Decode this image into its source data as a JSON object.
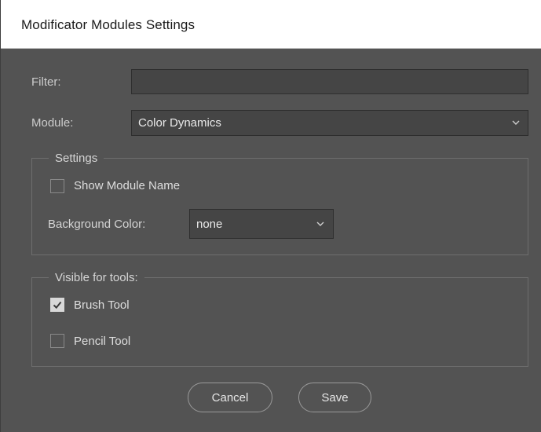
{
  "window": {
    "title": "Modificator Modules Settings"
  },
  "filter": {
    "label": "Filter:",
    "value": ""
  },
  "module": {
    "label": "Module:",
    "selected": "Color Dynamics"
  },
  "settings": {
    "legend": "Settings",
    "show_module_name": {
      "label": "Show Module Name",
      "checked": false
    },
    "background_color": {
      "label": "Background Color:",
      "selected": "none"
    }
  },
  "visible_for_tools": {
    "legend": "Visible for tools:",
    "items": [
      {
        "label": "Brush Tool",
        "checked": true
      },
      {
        "label": "Pencil Tool",
        "checked": false
      }
    ]
  },
  "buttons": {
    "cancel": "Cancel",
    "save": "Save"
  },
  "colors": {
    "panel": "#535353",
    "field": "#454545",
    "titlebar": "#ffffff"
  }
}
